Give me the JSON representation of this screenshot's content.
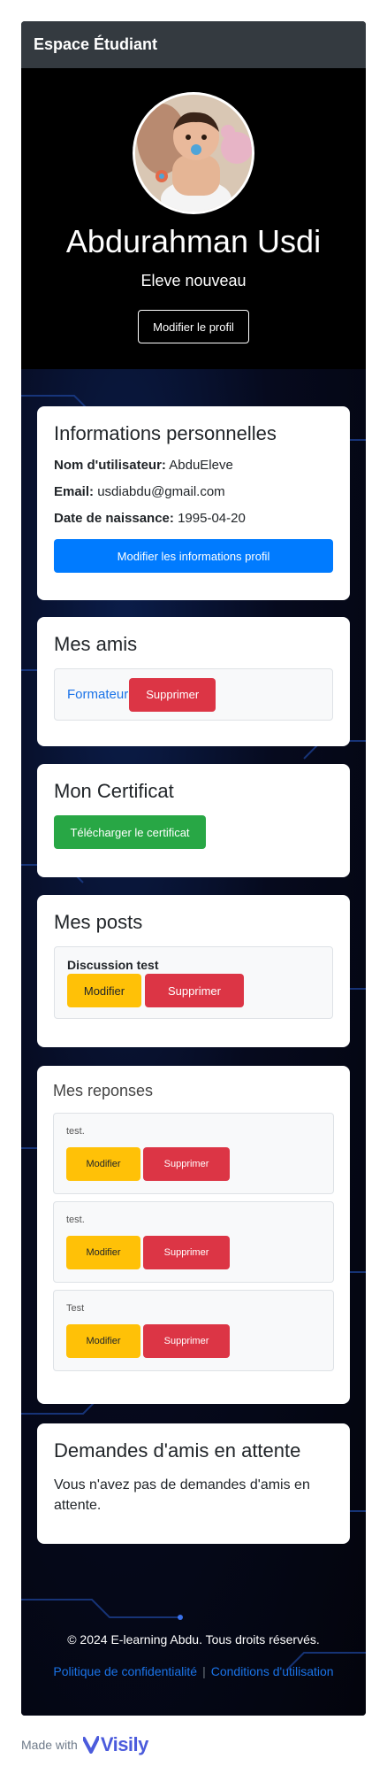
{
  "brand": "Espace Étudiant",
  "profile": {
    "name": "Abdurahman Usdi",
    "status": "Eleve nouveau",
    "edit_button": "Modifier le profil"
  },
  "personal": {
    "title": "Informations personnelles",
    "username_label": "Nom d'utilisateur:",
    "username": "AbduEleve",
    "email_label": "Email:",
    "email": "usdiabdu@gmail.com",
    "birth_label": "Date de naissance:",
    "birth": "1995-04-20",
    "edit_button": "Modifier les informations profil"
  },
  "friends": {
    "title": "Mes amis",
    "items": [
      {
        "name": "Formateur",
        "delete_label": "Supprimer"
      }
    ]
  },
  "certificate": {
    "title": "Mon Certificat",
    "download_button": "Télécharger le certificat"
  },
  "posts": {
    "title": "Mes posts",
    "items": [
      {
        "title": "Discussion test",
        "edit_label": "Modifier",
        "delete_label": "Supprimer"
      }
    ]
  },
  "replies": {
    "title": "Mes reponses",
    "items": [
      {
        "text": "test.",
        "edit_label": "Modifier",
        "delete_label": "Supprimer"
      },
      {
        "text": "test.",
        "edit_label": "Modifier",
        "delete_label": "Supprimer"
      },
      {
        "text": "Test",
        "edit_label": "Modifier",
        "delete_label": "Supprimer"
      }
    ]
  },
  "requests": {
    "title": "Demandes d'amis en attente",
    "empty_text": "Vous n'avez pas de demandes d'amis en attente."
  },
  "footer": {
    "copyright": "© 2024 E-learning Abdu. Tous droits réservés.",
    "privacy": "Politique de confidentialité",
    "terms": "Conditions d'utilisation",
    "separator": "|"
  },
  "madewith": {
    "label": "Made with",
    "product": "Visily"
  },
  "colors": {
    "topbar": "#343a40",
    "primary": "#007bff",
    "danger": "#dc3545",
    "success": "#28a745",
    "warning": "#ffc107",
    "link": "#1a73e8"
  }
}
